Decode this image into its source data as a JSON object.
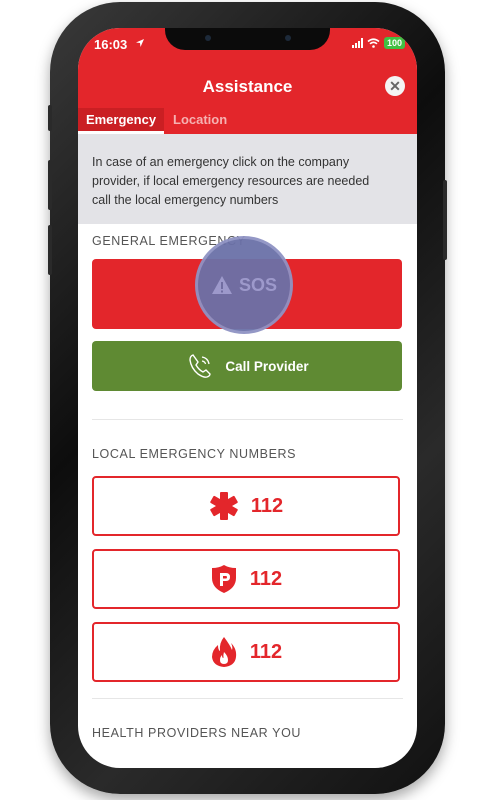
{
  "status_bar": {
    "time": "16:03",
    "battery": "100"
  },
  "header": {
    "title": "Assistance",
    "close_icon": "close-icon"
  },
  "tabs": [
    {
      "label": "Emergency",
      "active": true
    },
    {
      "label": "Location",
      "active": false
    }
  ],
  "info": {
    "line1": "In case of an emergency click on the company",
    "line2": "provider, if local emergency resources are needed",
    "line3": "call the local emergency numbers"
  },
  "general_emergency": {
    "heading": "GENERAL EMERGENCY",
    "sos_label": "SOS",
    "call_provider_label": "Call Provider"
  },
  "local_numbers": {
    "heading": "LOCAL EMERGENCY NUMBERS",
    "items": [
      {
        "icon": "medical-star-icon",
        "number": "112"
      },
      {
        "icon": "police-badge-icon",
        "number": "112"
      },
      {
        "icon": "fire-icon",
        "number": "112"
      }
    ]
  },
  "health_providers": {
    "heading": "HEALTH PROVIDERS NEAR YOU"
  },
  "colors": {
    "brand_red": "#e3262b",
    "call_green": "#5f8a33",
    "info_gray": "#e3e3e7"
  }
}
